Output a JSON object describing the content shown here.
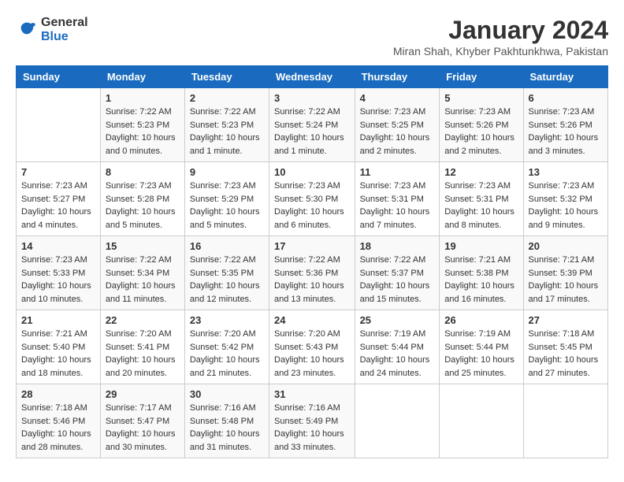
{
  "header": {
    "logo_general": "General",
    "logo_blue": "Blue",
    "month_title": "January 2024",
    "location": "Miran Shah, Khyber Pakhtunkhwa, Pakistan"
  },
  "days_of_week": [
    "Sunday",
    "Monday",
    "Tuesday",
    "Wednesday",
    "Thursday",
    "Friday",
    "Saturday"
  ],
  "weeks": [
    [
      {
        "day": "",
        "sunrise": "",
        "sunset": "",
        "daylight": ""
      },
      {
        "day": "1",
        "sunrise": "7:22 AM",
        "sunset": "5:23 PM",
        "daylight": "10 hours and 0 minutes."
      },
      {
        "day": "2",
        "sunrise": "7:22 AM",
        "sunset": "5:23 PM",
        "daylight": "10 hours and 1 minute."
      },
      {
        "day": "3",
        "sunrise": "7:22 AM",
        "sunset": "5:24 PM",
        "daylight": "10 hours and 1 minute."
      },
      {
        "day": "4",
        "sunrise": "7:23 AM",
        "sunset": "5:25 PM",
        "daylight": "10 hours and 2 minutes."
      },
      {
        "day": "5",
        "sunrise": "7:23 AM",
        "sunset": "5:26 PM",
        "daylight": "10 hours and 2 minutes."
      },
      {
        "day": "6",
        "sunrise": "7:23 AM",
        "sunset": "5:26 PM",
        "daylight": "10 hours and 3 minutes."
      }
    ],
    [
      {
        "day": "7",
        "sunrise": "7:23 AM",
        "sunset": "5:27 PM",
        "daylight": "10 hours and 4 minutes."
      },
      {
        "day": "8",
        "sunrise": "7:23 AM",
        "sunset": "5:28 PM",
        "daylight": "10 hours and 5 minutes."
      },
      {
        "day": "9",
        "sunrise": "7:23 AM",
        "sunset": "5:29 PM",
        "daylight": "10 hours and 5 minutes."
      },
      {
        "day": "10",
        "sunrise": "7:23 AM",
        "sunset": "5:30 PM",
        "daylight": "10 hours and 6 minutes."
      },
      {
        "day": "11",
        "sunrise": "7:23 AM",
        "sunset": "5:31 PM",
        "daylight": "10 hours and 7 minutes."
      },
      {
        "day": "12",
        "sunrise": "7:23 AM",
        "sunset": "5:31 PM",
        "daylight": "10 hours and 8 minutes."
      },
      {
        "day": "13",
        "sunrise": "7:23 AM",
        "sunset": "5:32 PM",
        "daylight": "10 hours and 9 minutes."
      }
    ],
    [
      {
        "day": "14",
        "sunrise": "7:23 AM",
        "sunset": "5:33 PM",
        "daylight": "10 hours and 10 minutes."
      },
      {
        "day": "15",
        "sunrise": "7:22 AM",
        "sunset": "5:34 PM",
        "daylight": "10 hours and 11 minutes."
      },
      {
        "day": "16",
        "sunrise": "7:22 AM",
        "sunset": "5:35 PM",
        "daylight": "10 hours and 12 minutes."
      },
      {
        "day": "17",
        "sunrise": "7:22 AM",
        "sunset": "5:36 PM",
        "daylight": "10 hours and 13 minutes."
      },
      {
        "day": "18",
        "sunrise": "7:22 AM",
        "sunset": "5:37 PM",
        "daylight": "10 hours and 15 minutes."
      },
      {
        "day": "19",
        "sunrise": "7:21 AM",
        "sunset": "5:38 PM",
        "daylight": "10 hours and 16 minutes."
      },
      {
        "day": "20",
        "sunrise": "7:21 AM",
        "sunset": "5:39 PM",
        "daylight": "10 hours and 17 minutes."
      }
    ],
    [
      {
        "day": "21",
        "sunrise": "7:21 AM",
        "sunset": "5:40 PM",
        "daylight": "10 hours and 18 minutes."
      },
      {
        "day": "22",
        "sunrise": "7:20 AM",
        "sunset": "5:41 PM",
        "daylight": "10 hours and 20 minutes."
      },
      {
        "day": "23",
        "sunrise": "7:20 AM",
        "sunset": "5:42 PM",
        "daylight": "10 hours and 21 minutes."
      },
      {
        "day": "24",
        "sunrise": "7:20 AM",
        "sunset": "5:43 PM",
        "daylight": "10 hours and 23 minutes."
      },
      {
        "day": "25",
        "sunrise": "7:19 AM",
        "sunset": "5:44 PM",
        "daylight": "10 hours and 24 minutes."
      },
      {
        "day": "26",
        "sunrise": "7:19 AM",
        "sunset": "5:44 PM",
        "daylight": "10 hours and 25 minutes."
      },
      {
        "day": "27",
        "sunrise": "7:18 AM",
        "sunset": "5:45 PM",
        "daylight": "10 hours and 27 minutes."
      }
    ],
    [
      {
        "day": "28",
        "sunrise": "7:18 AM",
        "sunset": "5:46 PM",
        "daylight": "10 hours and 28 minutes."
      },
      {
        "day": "29",
        "sunrise": "7:17 AM",
        "sunset": "5:47 PM",
        "daylight": "10 hours and 30 minutes."
      },
      {
        "day": "30",
        "sunrise": "7:16 AM",
        "sunset": "5:48 PM",
        "daylight": "10 hours and 31 minutes."
      },
      {
        "day": "31",
        "sunrise": "7:16 AM",
        "sunset": "5:49 PM",
        "daylight": "10 hours and 33 minutes."
      },
      {
        "day": "",
        "sunrise": "",
        "sunset": "",
        "daylight": ""
      },
      {
        "day": "",
        "sunrise": "",
        "sunset": "",
        "daylight": ""
      },
      {
        "day": "",
        "sunrise": "",
        "sunset": "",
        "daylight": ""
      }
    ]
  ]
}
